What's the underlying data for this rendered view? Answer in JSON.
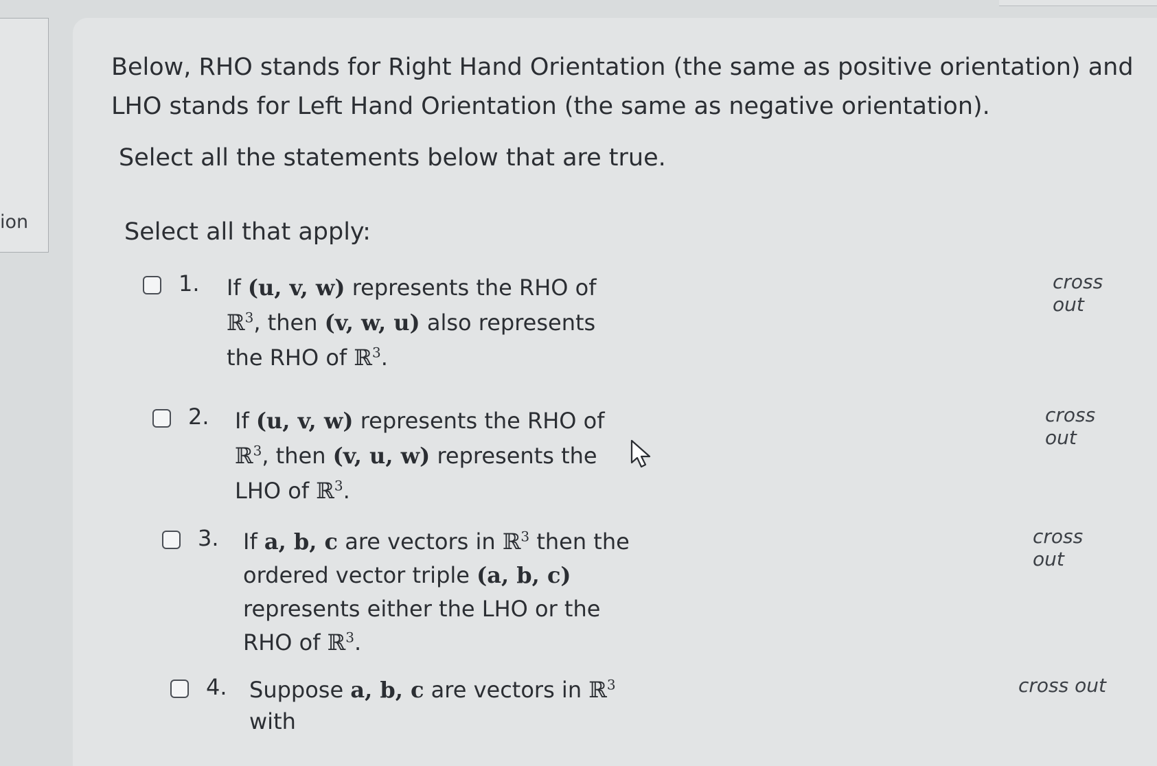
{
  "sidebar": {
    "tab_label": "ion"
  },
  "question": {
    "intro": "Below, RHO stands for Right Hand Orientation (the same as positive orientation) and LHO stands for Left Hand Orientation (the same as negative orientation).",
    "instruction": "Select all the statements below that are true.",
    "select_label": "Select all that apply:"
  },
  "options": [
    {
      "number": "1.",
      "crossout": "cross out",
      "text": {
        "a": "If ",
        "b": "(u, v, w)",
        "c": " represents the RHO of ",
        "d": "ℝ",
        "e": "3",
        "f": ", then ",
        "g": "(v, w, u)",
        "h": " also represents the RHO of ",
        "i": "ℝ",
        "j": "3",
        "k": "."
      }
    },
    {
      "number": "2.",
      "crossout": "cross out",
      "text": {
        "a": "If ",
        "b": "(u, v, w)",
        "c": " represents the RHO of ",
        "d": "ℝ",
        "e": "3",
        "f": ", then ",
        "g": "(v, u, w)",
        "h": " represents the LHO of ",
        "i": "ℝ",
        "j": "3",
        "k": "."
      }
    },
    {
      "number": "3.",
      "crossout": "cross out",
      "text": {
        "a": "If ",
        "b": "a, b, c",
        "c": " are vectors in ",
        "d": "ℝ",
        "e": "3",
        "f": " then the ordered vector triple ",
        "g": "(a, b, c)",
        "h": " represents either the LHO or the RHO of ",
        "i": "ℝ",
        "j": "3",
        "k": "."
      }
    },
    {
      "number": "4.",
      "crossout": "cross out",
      "text": {
        "a": "Suppose ",
        "b": "a, b, c",
        "c": " are vectors in ",
        "d": "ℝ",
        "e": "3",
        "f": " with"
      }
    }
  ]
}
